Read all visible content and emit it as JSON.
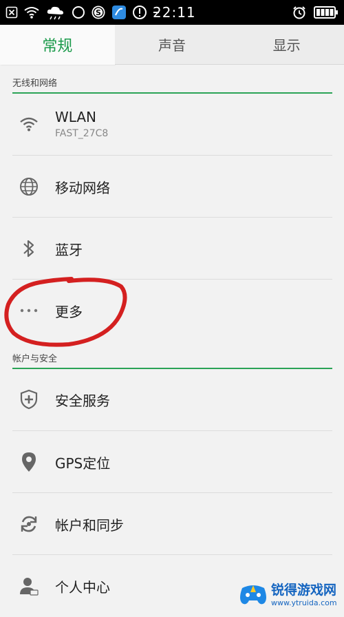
{
  "status_bar": {
    "time": "22:11",
    "icons": [
      "close-box-icon",
      "wifi-icon",
      "weather-rain-icon",
      "circle-icon",
      "s-app-icon",
      "shield-app-icon",
      "alert-icon",
      "dash-icon",
      "alarm-icon",
      "battery-icon"
    ]
  },
  "tabs": [
    {
      "label": "常规",
      "active": true
    },
    {
      "label": "声音",
      "active": false
    },
    {
      "label": "显示",
      "active": false
    }
  ],
  "sections": [
    {
      "header": "无线和网络",
      "items": [
        {
          "label": "WLAN",
          "sub": "FAST_27C8",
          "icon": "wifi-icon"
        },
        {
          "label": "移动网络",
          "icon": "globe-icon"
        },
        {
          "label": "蓝牙",
          "icon": "bluetooth-icon"
        },
        {
          "label": "更多",
          "icon": "more-dots-icon"
        }
      ]
    },
    {
      "header": "帐户与安全",
      "items": [
        {
          "label": "安全服务",
          "icon": "shield-plus-icon"
        },
        {
          "label": "GPS定位",
          "icon": "location-pin-icon"
        },
        {
          "label": "帐户和同步",
          "icon": "sync-icon"
        },
        {
          "label": "个人中心",
          "icon": "person-icon"
        }
      ]
    }
  ],
  "watermark": {
    "title": "锐得游戏网",
    "url": "www.ytruida.com"
  },
  "colors": {
    "accent": "#1a9a4a",
    "annotation": "#d42020",
    "watermark": "#1565c0"
  }
}
